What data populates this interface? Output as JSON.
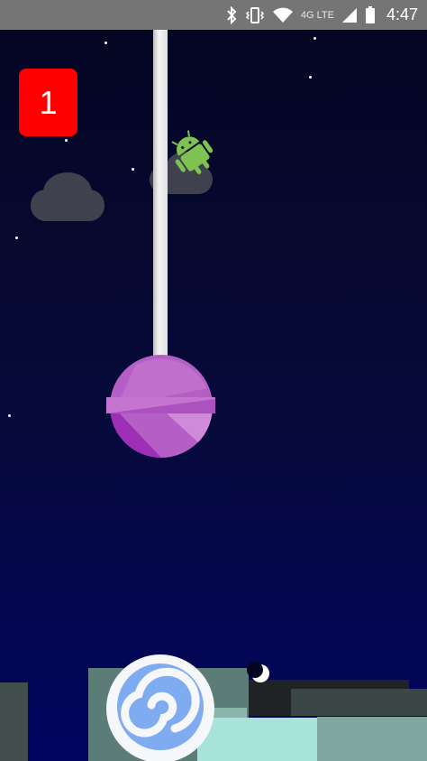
{
  "status_bar": {
    "time": "4:47",
    "network": "4G LTE",
    "icons": [
      "bluetooth-icon",
      "vibrate-icon",
      "wifi-icon",
      "cell-signal-icon",
      "battery-icon"
    ]
  },
  "game": {
    "score": "1",
    "colors": {
      "sky_top": "#050521",
      "sky_bottom": "#020460",
      "score_bg": "#ff0000",
      "lollipop": "#b85fc8",
      "android": "#7ec352",
      "cloud": "#40414f"
    },
    "sprites": [
      "android-player-sprite",
      "lollipop-obstacle",
      "swirl-candy-obstacle",
      "moon-icon"
    ]
  }
}
